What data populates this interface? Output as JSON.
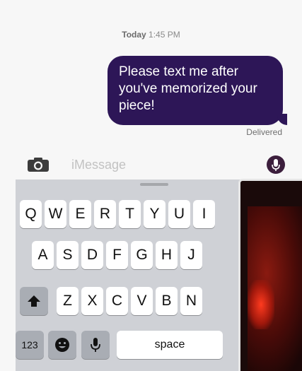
{
  "conversation": {
    "timestamp_day": "Today",
    "timestamp_time": "1:45 PM",
    "message_text": "Please text me after you've memorized your piece!",
    "status": "Delivered"
  },
  "input": {
    "placeholder": "iMessage"
  },
  "keyboard": {
    "row1": [
      "Q",
      "W",
      "E",
      "R",
      "T",
      "Y",
      "U",
      "I"
    ],
    "row2": [
      "A",
      "S",
      "D",
      "F",
      "G",
      "H",
      "J"
    ],
    "row3": [
      "Z",
      "X",
      "C",
      "V",
      "B",
      "N"
    ],
    "numbers_label": "123",
    "space_label": "space"
  },
  "colors": {
    "bubble": "#2d1657",
    "background": "#f7f7f7",
    "keyboard": "#cfd1d6"
  },
  "icons": [
    "camera-icon",
    "microphone-icon",
    "shift-icon",
    "emoji-icon",
    "dictation-icon"
  ]
}
